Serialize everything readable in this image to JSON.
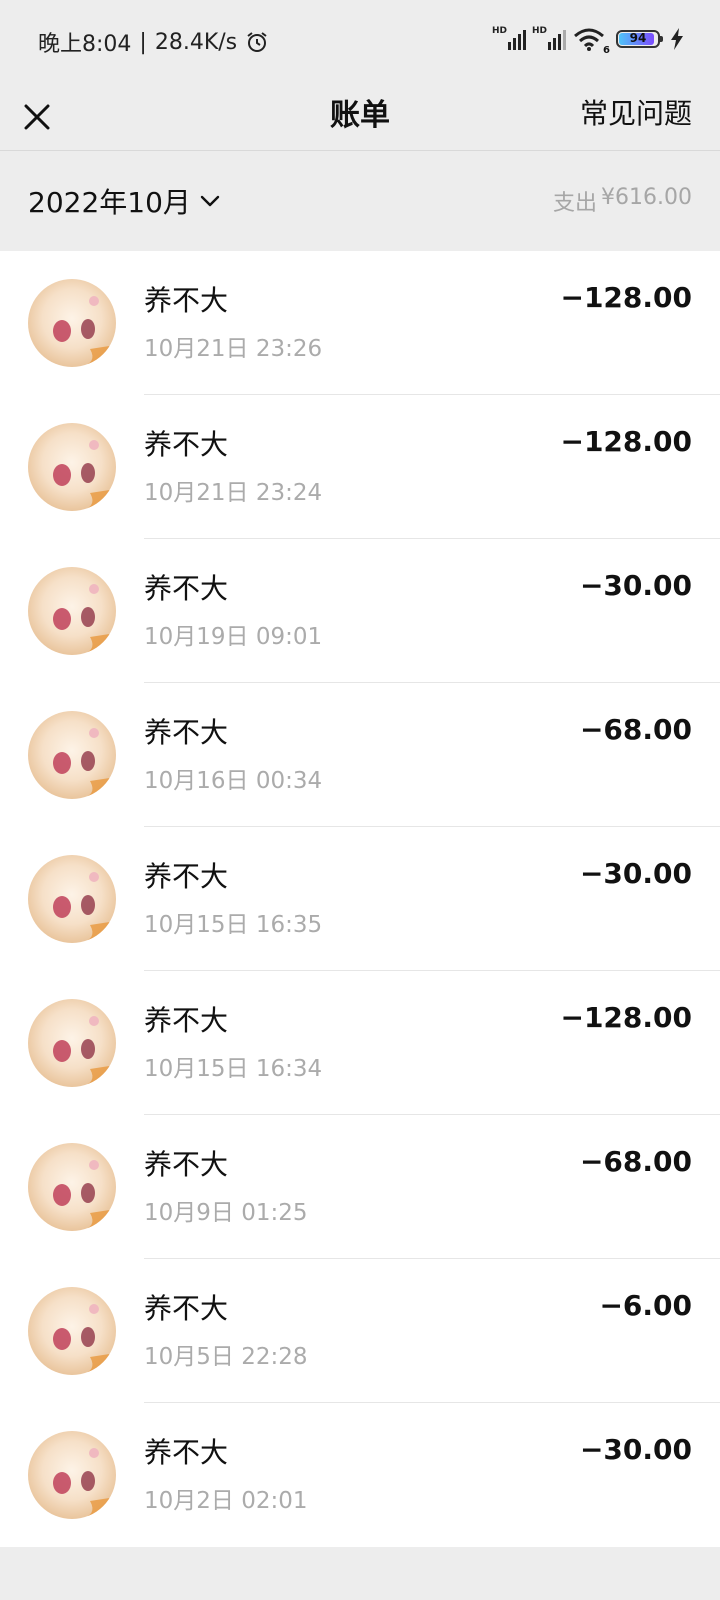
{
  "status_bar": {
    "time": "晚上8:04",
    "separator": "|",
    "net_speed": "28.4K/s",
    "signal_badge_1": "HD",
    "signal_badge_2": "HD",
    "wifi_sub": "6",
    "battery_level": "94",
    "icons": [
      "alarm-icon",
      "signal-icon",
      "signal-icon",
      "wifi-icon",
      "battery-icon",
      "charging-icon"
    ]
  },
  "header": {
    "title": "账单",
    "faq_label": "常见问题",
    "close_icon": "close-icon"
  },
  "filter": {
    "month": "2022年10月",
    "expense_label": "支出",
    "expense_amount": "¥616.00"
  },
  "bills": [
    {
      "merchant": "养不大",
      "datetime": "10月21日 23:26",
      "amount": "−128.00"
    },
    {
      "merchant": "养不大",
      "datetime": "10月21日 23:24",
      "amount": "−128.00"
    },
    {
      "merchant": "养不大",
      "datetime": "10月19日 09:01",
      "amount": "−30.00"
    },
    {
      "merchant": "养不大",
      "datetime": "10月16日 00:34",
      "amount": "−68.00"
    },
    {
      "merchant": "养不大",
      "datetime": "10月15日 16:35",
      "amount": "−30.00"
    },
    {
      "merchant": "养不大",
      "datetime": "10月15日 16:34",
      "amount": "−128.00"
    },
    {
      "merchant": "养不大",
      "datetime": "10月9日 01:25",
      "amount": "−68.00"
    },
    {
      "merchant": "养不大",
      "datetime": "10月5日 22:28",
      "amount": "−6.00"
    },
    {
      "merchant": "养不大",
      "datetime": "10月2日 02:01",
      "amount": "−30.00"
    }
  ]
}
